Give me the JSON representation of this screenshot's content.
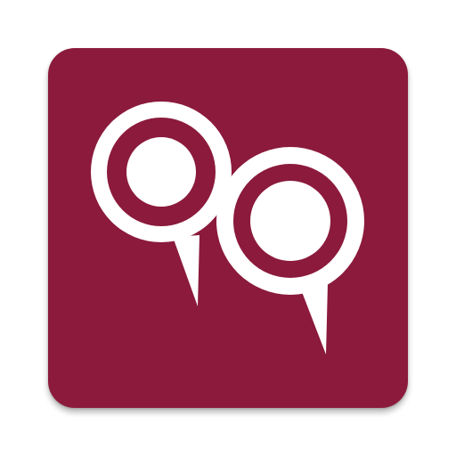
{
  "app_icon": {
    "icon": "double-location-pin-logo-icon",
    "colors": {
      "background": "#8b1a3c",
      "foreground": "#ffffff"
    }
  }
}
